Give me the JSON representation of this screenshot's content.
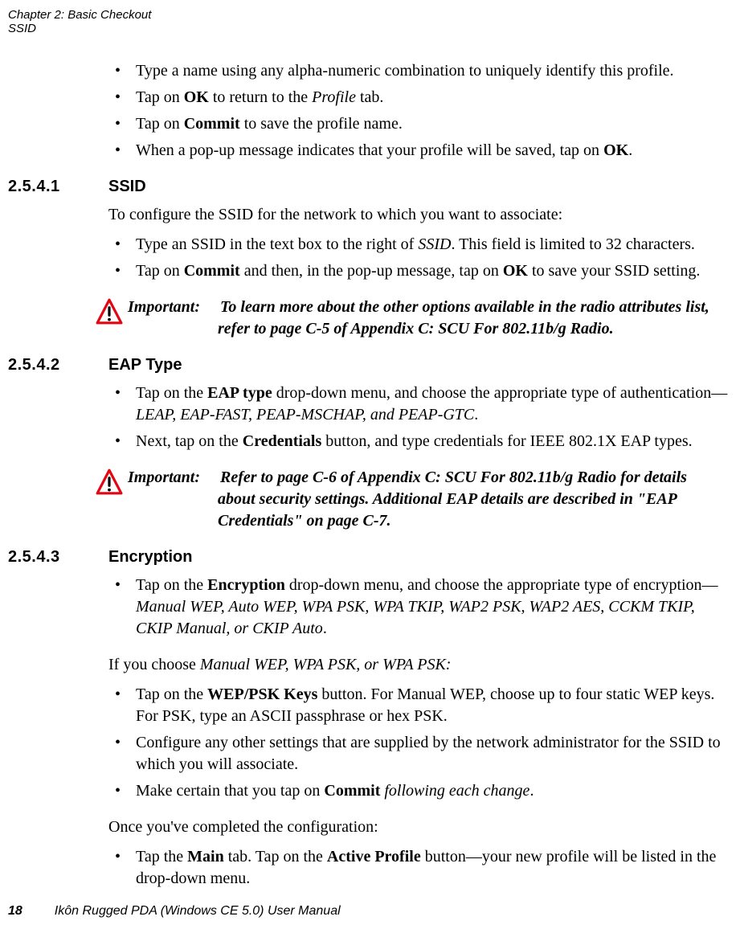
{
  "header": {
    "chapter_line": "Chapter 2:  Basic Checkout",
    "section_line": "SSID"
  },
  "intro_list": {
    "i0": {
      "pre": "Type a name using any alpha-numeric combination to uniquely identify this profile."
    },
    "i1": {
      "a": "Tap on ",
      "b": "OK",
      "c": " to return to the ",
      "d": "Profile",
      "e": " tab."
    },
    "i2": {
      "a": "Tap on ",
      "b": "Commit",
      "c": " to save the profile name."
    },
    "i3": {
      "a": "When a pop-up message indicates that your profile will be saved, tap on ",
      "b": "OK",
      "c": "."
    }
  },
  "sec1": {
    "num": "2.5.4.1",
    "title": "SSID",
    "lead": "To configure the SSID for the network to which you want to associate:",
    "list": {
      "i0": {
        "a": "Type an SSID in the text box to the right of ",
        "b": "SSID",
        "c": ". This field is limited to 32 characters."
      },
      "i1": {
        "a": "Tap on ",
        "b": "Commit",
        "c": " and then, in the pop-up message, tap on ",
        "d": "OK",
        "e": " to save your SSID setting."
      }
    },
    "note": {
      "label": "Important:",
      "line1": "To learn more about the other options available in the radio attributes list,",
      "line2": "refer to page C-5 of Appendix C: SCU For 802.11b/g Radio."
    }
  },
  "sec2": {
    "num": "2.5.4.2",
    "title": "EAP Type",
    "list": {
      "i0": {
        "a": "Tap on the ",
        "b": "EAP type",
        "c": " drop-down menu, and choose the appropriate type of authentication—",
        "d": "LEAP, EAP-FAST, PEAP-MSCHAP, and PEAP-GTC",
        "e": "."
      },
      "i1": {
        "a": "Next, tap on the ",
        "b": "Credentials",
        "c": " button, and type credentials for IEEE 802.1X EAP types."
      }
    },
    "note": {
      "label": "Important:",
      "line1": "Refer to page C-6 of Appendix C: SCU For 802.11b/g Radio for details",
      "line2": "about security settings. Additional EAP details are described in \"EAP Credentials\" on page C-7."
    }
  },
  "sec3": {
    "num": "2.5.4.3",
    "title": "Encryption",
    "list1": {
      "i0": {
        "a": "Tap on the ",
        "b": "Encryption",
        "c": " drop-down menu, and choose the appropriate type of encryption—",
        "d": "Manual WEP, Auto WEP, WPA PSK, WPA TKIP, WAP2 PSK, WAP2 AES, CCKM TKIP, CKIP Manual, or CKIP Auto",
        "e": "."
      }
    },
    "cond": {
      "a": "If you choose ",
      "b": "Manual WEP, WPA PSK, or WPA PSK:"
    },
    "list2": {
      "i0": {
        "a": "Tap on the ",
        "b": "WEP/PSK Keys",
        "c": " button. For Manual WEP, choose up to four static WEP keys. For PSK, type an ASCII passphrase or hex PSK."
      },
      "i1": {
        "a": "Configure any other settings that are supplied by the network administrator for the SSID to which you will associate."
      },
      "i2": {
        "a": "Make certain that you tap on ",
        "b": "Commit",
        "c": " ",
        "d": "following each change",
        "e": "."
      }
    },
    "done": "Once you've completed the configuration:",
    "list3": {
      "i0": {
        "a": "Tap the ",
        "b": "Main",
        "c": " tab. Tap on the ",
        "d": "Active Profile",
        "e": " button—your new profile will be listed in the drop-down menu."
      }
    }
  },
  "footer": {
    "page": "18",
    "title": "Ikôn Rugged PDA (Windows CE 5.0) User Manual"
  }
}
